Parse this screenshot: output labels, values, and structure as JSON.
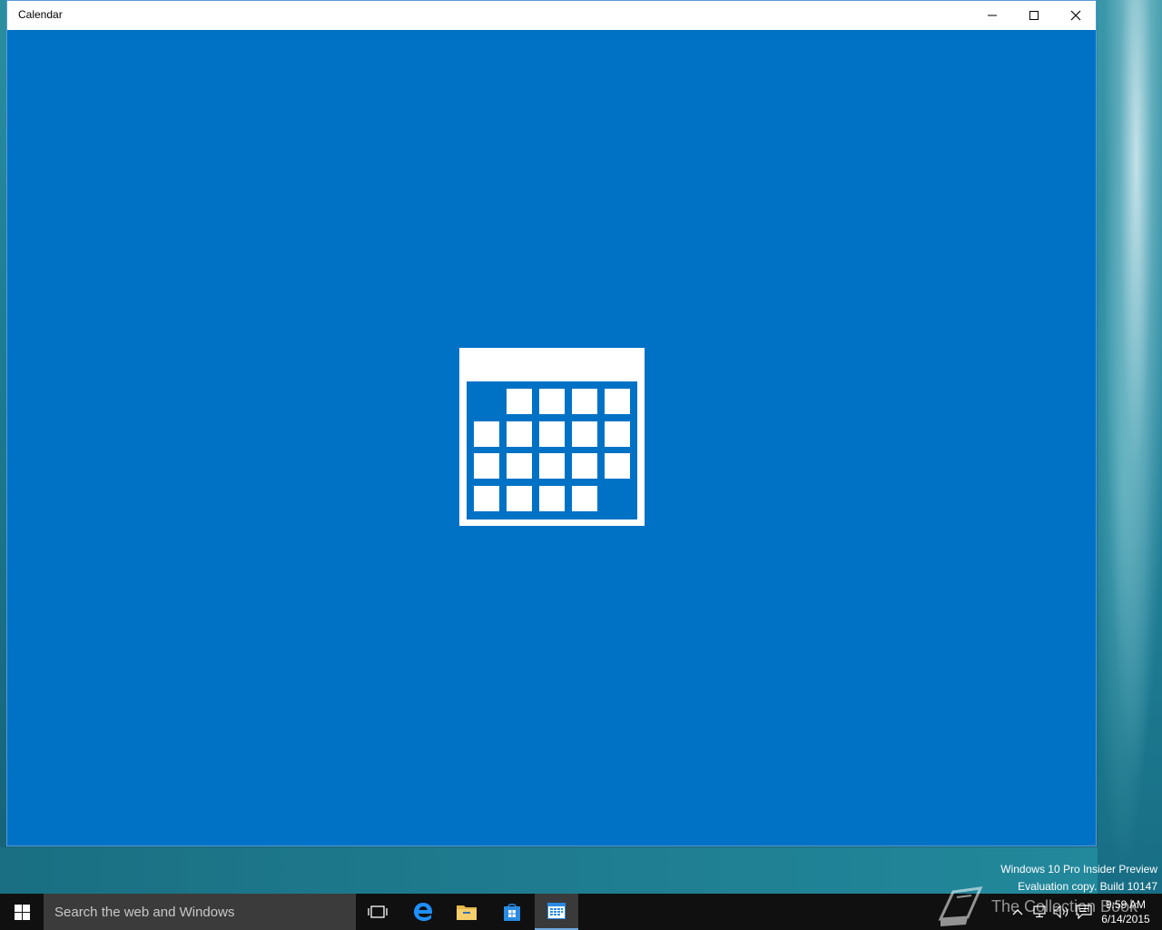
{
  "window": {
    "title": "Calendar",
    "background_color": "#0072c6",
    "splash_icon": "calendar-icon"
  },
  "watermark": {
    "line1": "Windows 10 Pro Insider Preview",
    "line2": "Evaluation copy. Build 10147"
  },
  "taskbar": {
    "search_placeholder": "Search the web and Windows",
    "icons": [
      "windows-logo-icon",
      "task-view-icon",
      "edge-icon",
      "file-explorer-icon",
      "store-icon",
      "calendar-icon"
    ],
    "active_app": "Calendar"
  },
  "tray": {
    "time": "9:59 AM",
    "date": "6/14/2015",
    "icons": [
      "chevron-up-icon",
      "network-icon",
      "volume-icon",
      "action-center-icon"
    ]
  },
  "overlay_logo": {
    "text": "The Collection Book"
  }
}
